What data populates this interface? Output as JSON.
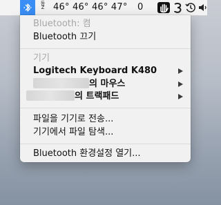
{
  "menubar": {
    "bluetooth_icon": "bluetooth-icon",
    "input_source_chars": [
      "등",
      "Z"
    ],
    "temps": "46°  46° 46° 47°",
    "count": "0",
    "status_icons": [
      "hand-icon",
      "shortcut-3-icon",
      "history-clock-icon",
      "volume-icon"
    ]
  },
  "menu": {
    "bt_status": "Bluetooth: 켬",
    "bt_off": "Bluetooth 끄기",
    "devices_header": "기기",
    "device1": "Logitech Keyboard K480",
    "device2_suffix": "의 마우스",
    "device3_suffix": "의 트랙패드",
    "send_file": "파일을 기기로 전송...",
    "browse_files": "기기에서 파일 탐색...",
    "open_prefs": "Bluetooth 환경설정 열기..."
  },
  "colors": {
    "status_active": "#3a8ef5",
    "menu_bg": "#f1f1f1",
    "disabled_text": "#a7a7a7"
  }
}
